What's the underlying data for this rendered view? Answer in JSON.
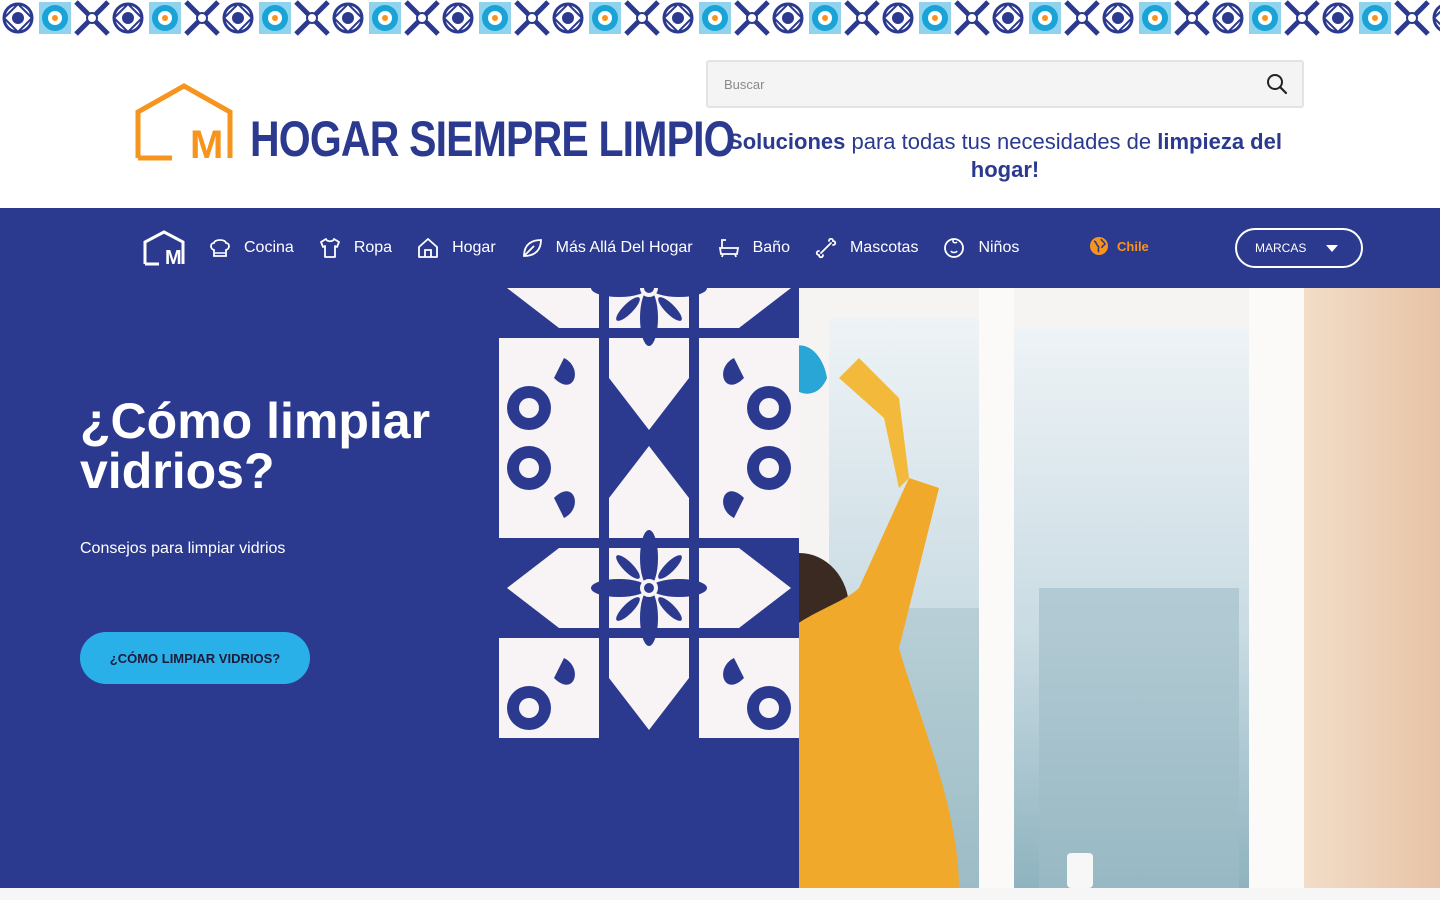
{
  "header": {
    "logo_text": "HOGAR SIEMPRE LIMPIO",
    "logo_mark_letter": "M",
    "search_placeholder": "Buscar",
    "tagline": {
      "part1": "Soluciones",
      "part2": " para todas tus necesidades de ",
      "part3": "limpieza del hogar!"
    }
  },
  "nav": {
    "home_icon": "house-m-icon",
    "items": [
      {
        "label": "Cocina",
        "icon": "chef-hat-icon"
      },
      {
        "label": "Ropa",
        "icon": "shirt-icon"
      },
      {
        "label": "Hogar",
        "icon": "house-icon"
      },
      {
        "label": "Más Allá Del Hogar",
        "icon": "leaf-icon"
      },
      {
        "label": "Baño",
        "icon": "bathtub-icon"
      },
      {
        "label": "Mascotas",
        "icon": "bone-icon"
      },
      {
        "label": "Niños",
        "icon": "baby-face-icon"
      }
    ],
    "country": "Chile",
    "brands_label": "MARCAS"
  },
  "hero": {
    "title": "¿Cómo limpiar vidrios?",
    "subtitle": "Consejos para limpiar vidrios",
    "button_label": "¿CÓMO LIMPIAR VIDRIOS?"
  },
  "colors": {
    "primary": "#2b3a8f",
    "accent_orange": "#f7941d",
    "accent_cyan": "#2ab0e9"
  }
}
